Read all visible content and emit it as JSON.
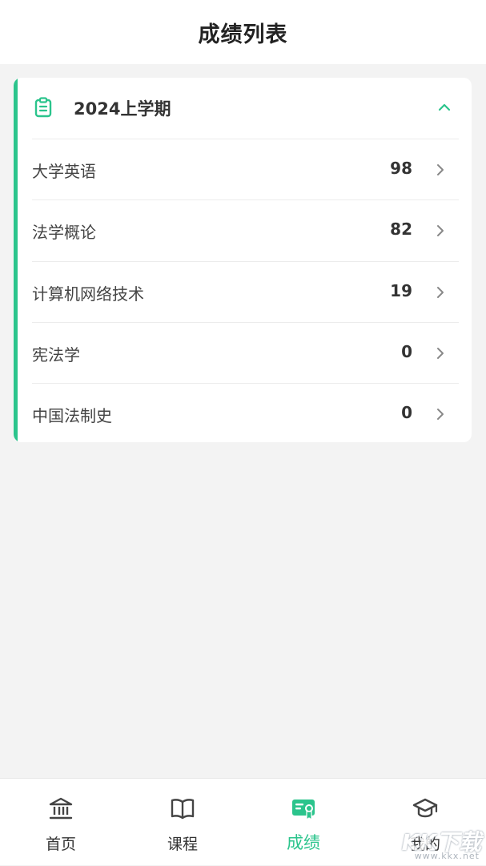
{
  "header": {
    "title": "成绩列表"
  },
  "term": {
    "title": "2024上学期",
    "expanded": true
  },
  "grades": [
    {
      "name": "大学英语",
      "score": "98"
    },
    {
      "name": "法学概论",
      "score": "82"
    },
    {
      "name": "计算机网络技术",
      "score": "19"
    },
    {
      "name": "宪法学",
      "score": "0"
    },
    {
      "name": "中国法制史",
      "score": "0"
    }
  ],
  "tabbar": {
    "active": 2,
    "tabs": [
      {
        "label": "首页",
        "icon": "bank-icon"
      },
      {
        "label": "课程",
        "icon": "book-icon"
      },
      {
        "label": "成绩",
        "icon": "certificate-icon"
      },
      {
        "label": "我的",
        "icon": "graduation-cap-icon"
      }
    ]
  },
  "watermark": {
    "main": "KK下载",
    "sub": "www.kkx.net"
  },
  "colors": {
    "accent": "#2bc48c",
    "background": "#f3f3f3",
    "text": "#333333"
  }
}
